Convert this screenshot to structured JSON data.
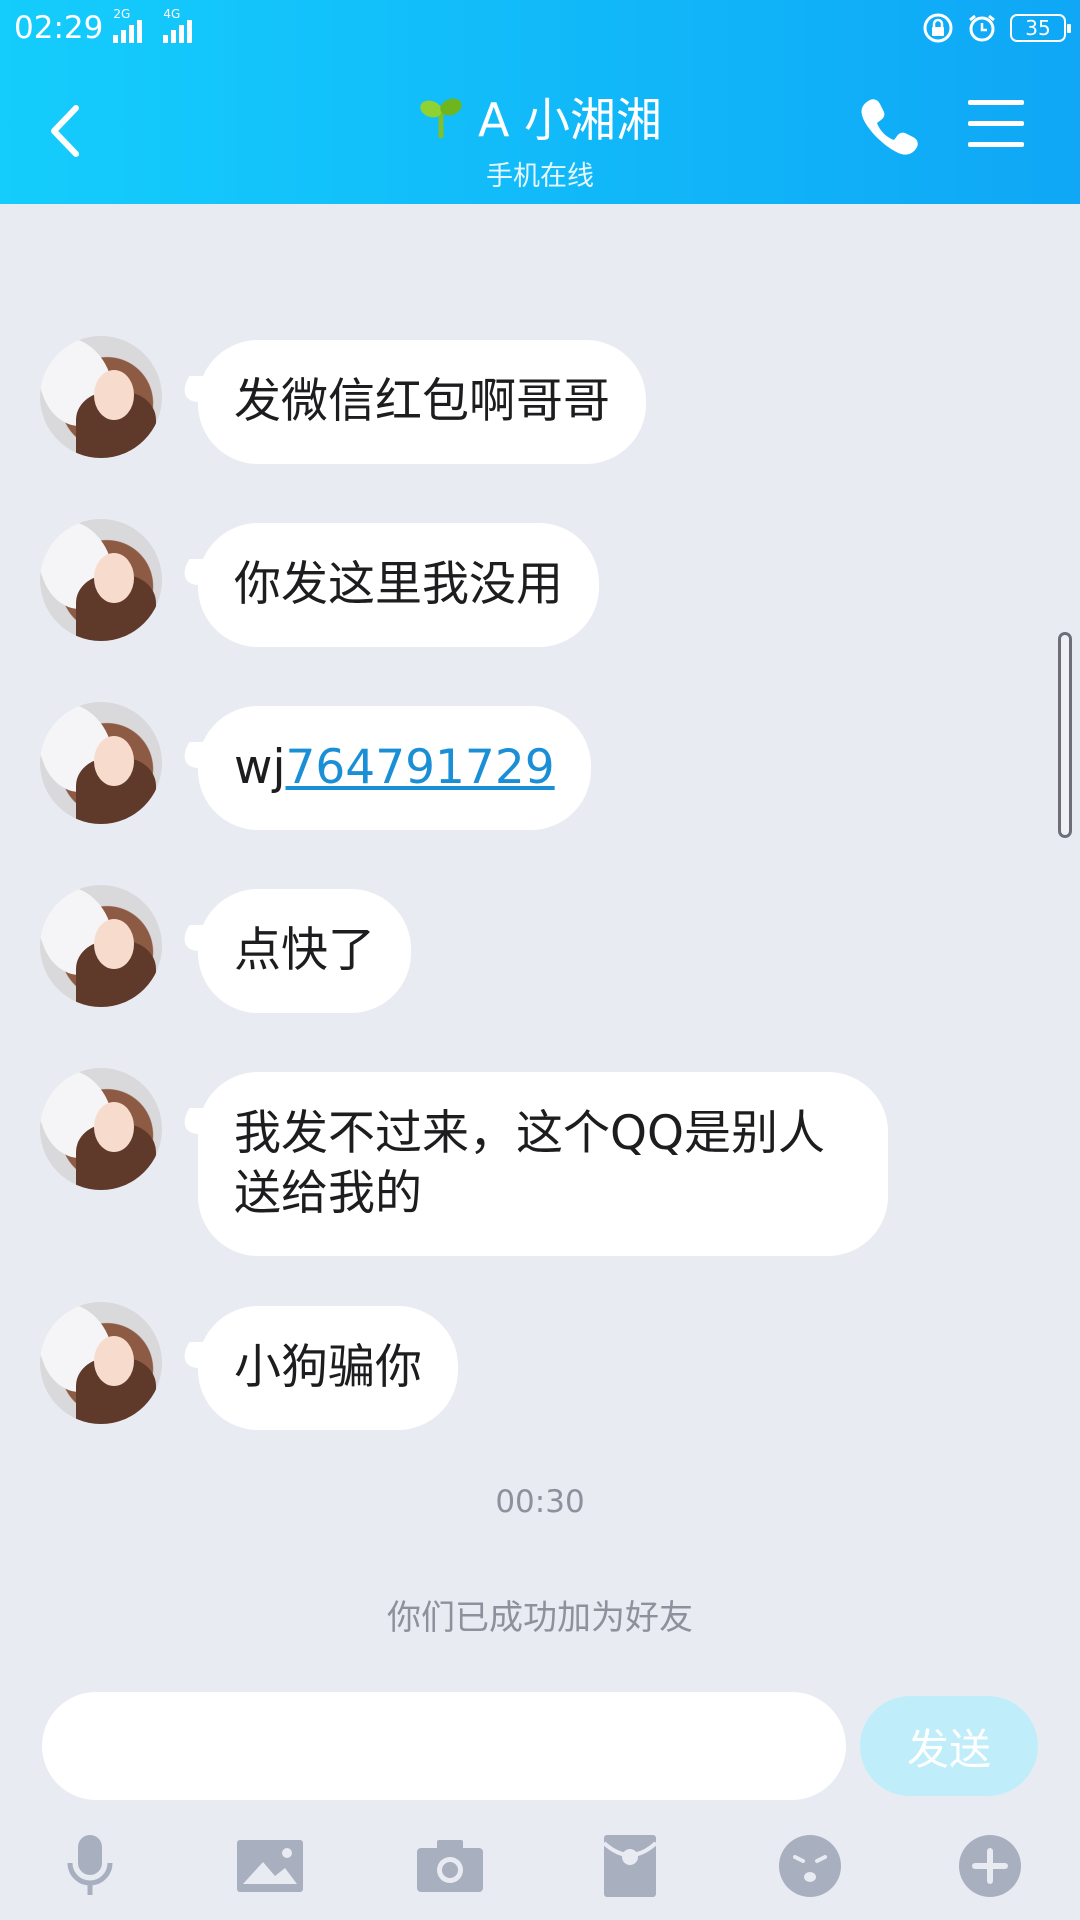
{
  "status_bar": {
    "time": "02:29",
    "network_1": "2G",
    "network_2": "4G",
    "battery": "35"
  },
  "header": {
    "contact_name": "A 小湘湘",
    "status": "手机在线"
  },
  "messages": [
    {
      "text": "发微信红包啊哥哥"
    },
    {
      "text": "你发这里我没用"
    },
    {
      "prefix": "wj",
      "link": "764791729"
    },
    {
      "text": "点快了"
    },
    {
      "line1": "我发不过来，这个QQ是别人",
      "line2": "送给我的"
    },
    {
      "text": "小狗骗你"
    }
  ],
  "timestamp": "00:30",
  "system_note": "你们已成功加为好友",
  "input": {
    "placeholder": "",
    "send_label": "发送"
  },
  "toolbar_icons": [
    "microphone-icon",
    "image-icon",
    "camera-icon",
    "red-packet-icon",
    "emoji-icon",
    "plus-icon"
  ],
  "colors": {
    "header_start": "#14cdfc",
    "header_end": "#0fa7f6",
    "background": "#e9ebf3",
    "link": "#1b8fd6",
    "send_disabled": "#bfeefa"
  }
}
